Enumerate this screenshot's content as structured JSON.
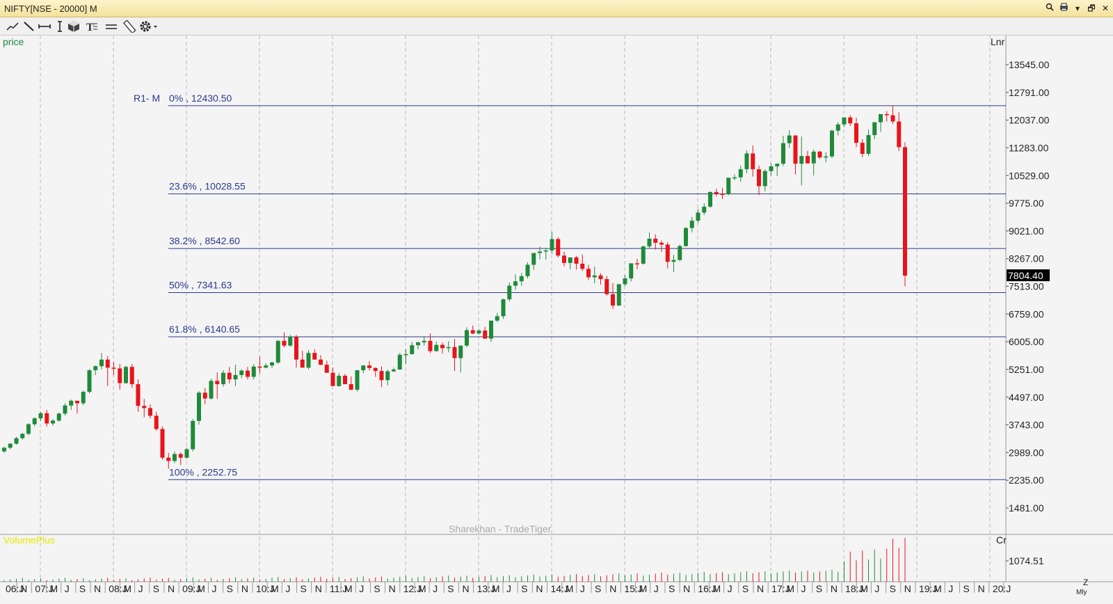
{
  "window": {
    "title": "NIFTY[NSE - 20000] M"
  },
  "toolbar": {
    "tools": [
      "trend-tool",
      "line-tool",
      "horizontal-line-tool",
      "vertical-line-tool",
      "cube-tool",
      "text-tool",
      "parallel-lines-tool",
      "ruler-tool",
      "settings-tool"
    ]
  },
  "chart": {
    "price_label": "price",
    "scale_label": "Lnr",
    "watermark": "Sharekhan - TradeTiger",
    "current_price": "7804.40",
    "price_ticks": [
      "13545.00",
      "12791.00",
      "12037.00",
      "11283.00",
      "10529.00",
      "9775.00",
      "9021.00",
      "8267.00",
      "7513.00",
      "6759.00",
      "6005.00",
      "5251.00",
      "4497.00",
      "3743.00",
      "2989.00",
      "2235.00",
      "1481.00"
    ],
    "fib": {
      "title": "R1- M",
      "levels": [
        {
          "pct": "0%",
          "value": "12430.50",
          "label": "0%   , 12430.50"
        },
        {
          "pct": "23.6%",
          "value": "10028.55",
          "label": "23.6%   , 10028.55"
        },
        {
          "pct": "38.2%",
          "value": "8542.60",
          "label": "38.2%   , 8542.60"
        },
        {
          "pct": "50%",
          "value": "7341.63",
          "label": "50%   , 7341.63"
        },
        {
          "pct": "61.8%",
          "value": "6140.65",
          "label": "61.8%   , 6140.65"
        },
        {
          "pct": "100%",
          "value": "2252.75",
          "label": "100%   , 2252.75"
        }
      ]
    },
    "volume_label": "VolumePlus",
    "volume_scale_label": "Cr",
    "volume_tick": "1074.51",
    "zoom_label": "Z",
    "period_label": "Mly",
    "x_labels": [
      "06:J",
      "N",
      "07:J",
      "M",
      "J",
      "S",
      "N",
      "08:J",
      "M",
      "J",
      "S",
      "N",
      "09:J",
      "M",
      "J",
      "S",
      "N",
      "10:J",
      "M",
      "J",
      "S",
      "N",
      "11:J",
      "M",
      "J",
      "S",
      "N",
      "12:J",
      "M",
      "J",
      "S",
      "N",
      "13:J",
      "M",
      "J",
      "S",
      "N",
      "14:J",
      "M",
      "J",
      "S",
      "N",
      "15:J",
      "M",
      "J",
      "S",
      "N",
      "16:J",
      "M",
      "J",
      "S",
      "N",
      "17:J",
      "M",
      "J",
      "S",
      "N",
      "18:J",
      "M",
      "J",
      "S",
      "N",
      "19:J",
      "M",
      "J",
      "S",
      "N",
      "20:J"
    ],
    "colors": {
      "up": "#1f8a3a",
      "down": "#e8141c",
      "fib": "#2b3a8c",
      "grid": "#b8b8b8",
      "volume_label": "#e8e800",
      "price_label": "#1f8a3a"
    }
  },
  "chart_data": {
    "type": "candlestick",
    "interval": "monthly",
    "symbol": "NIFTY",
    "ohlc": [
      [
        3020,
        3150,
        2980,
        3120
      ],
      [
        3120,
        3250,
        3080,
        3230
      ],
      [
        3230,
        3420,
        3200,
        3380
      ],
      [
        3380,
        3520,
        3340,
        3500
      ],
      [
        3500,
        3790,
        3460,
        3760
      ],
      [
        3760,
        3950,
        3700,
        3920
      ],
      [
        3920,
        4100,
        3850,
        4060
      ],
      [
        4060,
        4150,
        3700,
        3780
      ],
      [
        3780,
        3900,
        3720,
        3860
      ],
      [
        3860,
        4080,
        3830,
        4050
      ],
      [
        4050,
        4330,
        4000,
        4270
      ],
      [
        4270,
        4430,
        4150,
        4400
      ],
      [
        4400,
        4390,
        4050,
        4330
      ],
      [
        4330,
        4680,
        4280,
        4640
      ],
      [
        4640,
        5260,
        4600,
        5230
      ],
      [
        5230,
        5360,
        5100,
        5340
      ],
      [
        5340,
        5700,
        5250,
        5520
      ],
      [
        5520,
        5620,
        4800,
        5300
      ],
      [
        5300,
        5450,
        5100,
        5280
      ],
      [
        5280,
        5400,
        4700,
        4880
      ],
      [
        4880,
        5350,
        4860,
        5320
      ],
      [
        5320,
        5400,
        4750,
        4850
      ],
      [
        4850,
        4980,
        4100,
        4260
      ],
      [
        4260,
        4450,
        3950,
        4200
      ],
      [
        4200,
        4300,
        3920,
        3990
      ],
      [
        3990,
        4100,
        3580,
        3630
      ],
      [
        3630,
        3700,
        2800,
        2850
      ],
      [
        2850,
        2980,
        2550,
        2760
      ],
      [
        2760,
        3020,
        2700,
        2950
      ],
      [
        2950,
        2990,
        2650,
        2850
      ],
      [
        2850,
        3120,
        2820,
        3080
      ],
      [
        3080,
        3900,
        3020,
        3850
      ],
      [
        3850,
        4660,
        3750,
        4620
      ],
      [
        4620,
        4750,
        4300,
        4460
      ],
      [
        4460,
        5000,
        4430,
        4940
      ],
      [
        4940,
        5170,
        4450,
        4850
      ],
      [
        4850,
        5230,
        4780,
        5160
      ],
      [
        5160,
        5320,
        4870,
        4980
      ],
      [
        4980,
        5380,
        4800,
        5100
      ],
      [
        5100,
        5260,
        5010,
        5220
      ],
      [
        5220,
        5320,
        4980,
        5050
      ],
      [
        5050,
        5400,
        4980,
        5330
      ],
      [
        5330,
        5600,
        5140,
        5300
      ],
      [
        5300,
        5420,
        5280,
        5360
      ],
      [
        5360,
        5470,
        5290,
        5440
      ],
      [
        5440,
        6050,
        5400,
        6030
      ],
      [
        6030,
        6260,
        5850,
        5900
      ],
      [
        5900,
        6190,
        5870,
        6140
      ],
      [
        6140,
        6190,
        5300,
        5520
      ],
      [
        5520,
        5760,
        5320,
        5300
      ],
      [
        5300,
        5780,
        5260,
        5700
      ],
      [
        5700,
        5800,
        5560,
        5520
      ],
      [
        5520,
        5640,
        5360,
        5380
      ],
      [
        5380,
        5490,
        5220,
        5160
      ],
      [
        5160,
        5300,
        4890,
        4800
      ],
      [
        4800,
        5150,
        4780,
        5080
      ],
      [
        5080,
        5130,
        4910,
        4850
      ],
      [
        4850,
        5060,
        4690,
        4700
      ],
      [
        4700,
        5150,
        4650,
        5230
      ],
      [
        5230,
        5360,
        5150,
        5360
      ],
      [
        5360,
        5480,
        5220,
        5290
      ],
      [
        5290,
        5310,
        5050,
        5210
      ],
      [
        5210,
        5330,
        4770,
        4960
      ],
      [
        4960,
        5250,
        4820,
        5200
      ],
      [
        5200,
        5300,
        5180,
        5250
      ],
      [
        5250,
        5700,
        5240,
        5650
      ],
      [
        5650,
        5800,
        5400,
        5670
      ],
      [
        5670,
        6000,
        5650,
        5910
      ],
      [
        5910,
        6000,
        5800,
        5990
      ],
      [
        5990,
        6130,
        5900,
        6030
      ],
      [
        6030,
        6230,
        5700,
        5750
      ],
      [
        5750,
        6010,
        5740,
        5920
      ],
      [
        5920,
        5980,
        5680,
        5830
      ],
      [
        5830,
        6020,
        5720,
        5860
      ],
      [
        5860,
        6080,
        5210,
        5560
      ],
      [
        5560,
        5850,
        5170,
        5900
      ],
      [
        5900,
        6400,
        5860,
        6320
      ],
      [
        6320,
        6450,
        6210,
        6230
      ],
      [
        6230,
        6350,
        6200,
        6310
      ],
      [
        6310,
        6410,
        6130,
        6090
      ],
      [
        6090,
        6530,
        6000,
        6580
      ],
      [
        6580,
        6790,
        6540,
        6700
      ],
      [
        6700,
        7180,
        6630,
        7160
      ],
      [
        7160,
        7620,
        7100,
        7530
      ],
      [
        7530,
        7840,
        7420,
        7650
      ],
      [
        7650,
        7880,
        7530,
        7790
      ],
      [
        7790,
        8170,
        7730,
        8100
      ],
      [
        8100,
        8410,
        7960,
        8420
      ],
      [
        8420,
        8600,
        8250,
        8460
      ],
      [
        8460,
        8560,
        8240,
        8490
      ],
      [
        8490,
        8990,
        8400,
        8800
      ],
      [
        8800,
        8850,
        8300,
        8350
      ],
      [
        8350,
        8460,
        8060,
        8150
      ],
      [
        8150,
        8300,
        7980,
        8300
      ],
      [
        8300,
        8340,
        7970,
        8130
      ],
      [
        8130,
        8380,
        7930,
        7990
      ],
      [
        7990,
        8100,
        7680,
        7760
      ],
      [
        7760,
        8050,
        7600,
        7810
      ],
      [
        7810,
        7870,
        7560,
        7710
      ],
      [
        7710,
        7800,
        7260,
        7300
      ],
      [
        7300,
        7600,
        6900,
        6990
      ],
      [
        6990,
        7580,
        6980,
        7570
      ],
      [
        7570,
        7820,
        7520,
        7730
      ],
      [
        7730,
        8120,
        7650,
        8140
      ],
      [
        8140,
        8260,
        7980,
        8130
      ],
      [
        8130,
        8620,
        8100,
        8600
      ],
      [
        8600,
        8980,
        8540,
        8810
      ],
      [
        8810,
        8930,
        8510,
        8700
      ],
      [
        8700,
        8760,
        8450,
        8650
      ],
      [
        8650,
        8720,
        8000,
        8180
      ],
      [
        8180,
        8370,
        7900,
        8230
      ],
      [
        8230,
        8650,
        8200,
        8610
      ],
      [
        8610,
        9130,
        8590,
        9100
      ],
      [
        9100,
        9400,
        8980,
        9300
      ],
      [
        9300,
        9620,
        9230,
        9520
      ],
      [
        9520,
        9770,
        9450,
        9680
      ],
      [
        9680,
        10100,
        9650,
        10080
      ],
      [
        10080,
        10170,
        9960,
        10030
      ],
      [
        10030,
        10190,
        9890,
        10020
      ],
      [
        10020,
        10430,
        9990,
        10470
      ],
      [
        10470,
        10560,
        10400,
        10480
      ],
      [
        10480,
        10800,
        10360,
        10700
      ],
      [
        10700,
        11210,
        10590,
        11130
      ],
      [
        11130,
        11350,
        10500,
        10700
      ],
      [
        10700,
        10800,
        10000,
        10240
      ],
      [
        10240,
        10700,
        10100,
        10650
      ],
      [
        10650,
        10850,
        10530,
        10780
      ],
      [
        10780,
        10860,
        10520,
        10850
      ],
      [
        10850,
        11610,
        10790,
        11410
      ],
      [
        11410,
        11760,
        11280,
        11620
      ],
      [
        11620,
        11550,
        10560,
        10850
      ],
      [
        10850,
        11590,
        10260,
        11060
      ],
      [
        11060,
        11200,
        10860,
        10860
      ],
      [
        10860,
        11240,
        10530,
        11180
      ],
      [
        11180,
        11200,
        10980,
        11020
      ],
      [
        11020,
        11160,
        10890,
        11050
      ],
      [
        11050,
        11780,
        11000,
        11750
      ],
      [
        11750,
        11980,
        11620,
        11920
      ],
      [
        11920,
        12100,
        11850,
        12110
      ],
      [
        12110,
        12170,
        11880,
        11950
      ],
      [
        11950,
        12100,
        11300,
        11420
      ],
      [
        11420,
        11520,
        11030,
        11120
      ],
      [
        11120,
        11780,
        11060,
        11630
      ],
      [
        11630,
        11800,
        11520,
        11980
      ],
      [
        11980,
        12140,
        11720,
        12200
      ],
      [
        12200,
        12280,
        12000,
        12170
      ],
      [
        12170,
        12430,
        11930,
        12000
      ],
      [
        12000,
        12250,
        11200,
        11300
      ],
      [
        11300,
        11430,
        7510,
        7804
      ]
    ]
  }
}
